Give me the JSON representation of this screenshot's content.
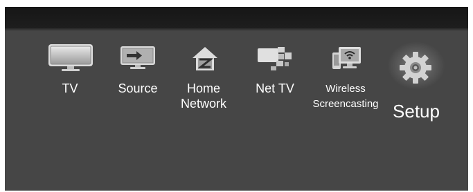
{
  "menu": {
    "items": [
      {
        "label": "TV",
        "icon": "tv-icon"
      },
      {
        "label": "Source",
        "icon": "source-icon"
      },
      {
        "label_line1": "Home",
        "label_line2": "Network",
        "icon": "home-network-icon"
      },
      {
        "label": "Net TV",
        "icon": "net-tv-icon"
      },
      {
        "label_line1": "Wireless",
        "label_line2": "Screencasting",
        "icon": "wireless-screencasting-icon"
      },
      {
        "label": "Setup",
        "icon": "gear-icon",
        "selected": true
      }
    ]
  },
  "colors": {
    "background": "#464646",
    "top_bar": "#1a1a1a",
    "text": "#ffffff"
  }
}
